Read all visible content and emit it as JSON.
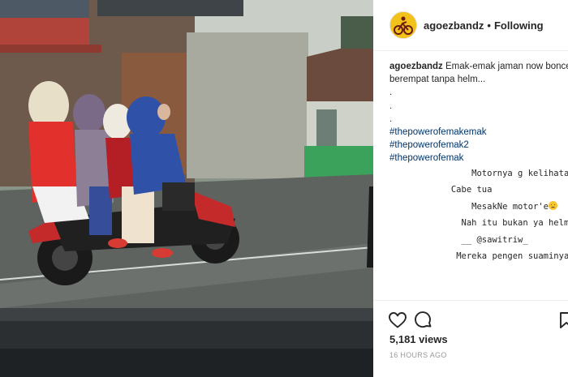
{
  "post": {
    "username": "agoezbandz",
    "separator": "•",
    "follow_status": "Following",
    "caption_user": "agoezbandz",
    "caption_text_1": "Emak-emak jaman now bonce",
    "caption_text_2": "berempat tanpa helm...",
    "dots": [
      ".",
      ".",
      "."
    ],
    "hashtags": [
      "#thepowerofemakemak",
      "#thepowerofemak2",
      "#thepowerofemak"
    ],
    "comments": [
      {
        "pad": "                ",
        "text": "Motornya g kelihatan",
        "emoji": false
      },
      {
        "pad": "            ",
        "text": "Cabe tua",
        "emoji": false
      },
      {
        "pad": "                ",
        "text": "MesakNe motor'e",
        "emoji": true
      },
      {
        "pad": "              ",
        "text": "Nah itu bukan ya helm",
        "emoji": false
      },
      {
        "pad": "              ",
        "text": "__ @sawitriw_",
        "emoji": false
      },
      {
        "pad": "             ",
        "text": "Mereka pengen suaminya jadi dud",
        "emoji": false
      }
    ],
    "views": "5,181 views",
    "timestamp": "16 HOURS AGO"
  },
  "icons": [
    "heart-icon",
    "comment-icon",
    "bookmark-icon"
  ],
  "colors": {
    "hashtag": "#003569",
    "text": "#262626",
    "muted": "#999999",
    "avatar_bg": "#f3c21a"
  }
}
